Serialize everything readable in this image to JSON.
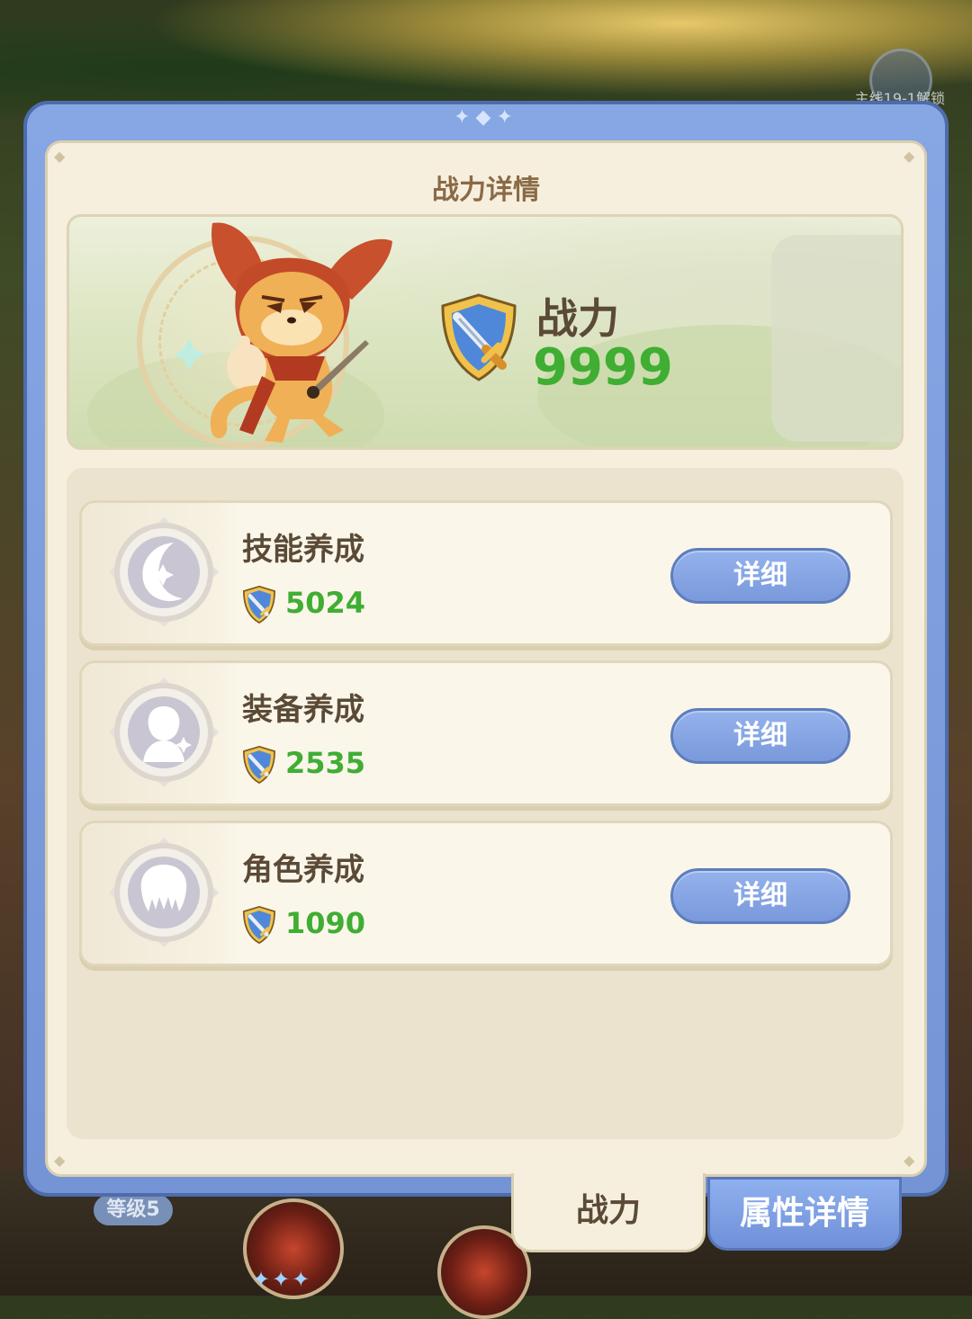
{
  "background": {
    "lock_hint": "主线19-1解锁",
    "level_tag": "等级5"
  },
  "panel": {
    "title": "战力详情",
    "power": {
      "label": "战力",
      "value": "9999"
    },
    "items": [
      {
        "name": "技能养成",
        "value": "5024",
        "button": "详细",
        "icon": "moon-sparkle-icon"
      },
      {
        "name": "装备养成",
        "value": "2535",
        "button": "详细",
        "icon": "hooded-figure-icon"
      },
      {
        "name": "角色养成",
        "value": "1090",
        "button": "详细",
        "icon": "character-head-icon"
      }
    ]
  },
  "tabs": {
    "power": "战力",
    "attributes": "属性详情"
  },
  "colors": {
    "frame_blue": "#7494d6",
    "panel_cream": "#f6efdd",
    "value_green": "#3fae33",
    "text_brown": "#5b4a36",
    "button_blue": "#7a99dc"
  }
}
